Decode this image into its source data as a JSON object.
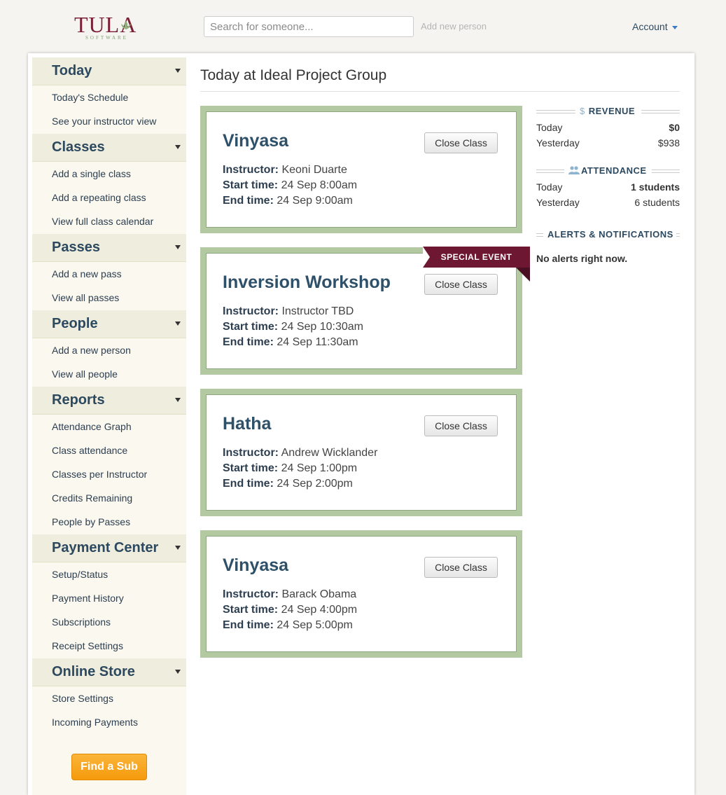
{
  "brand": {
    "name": "TULA",
    "sub": "SOFTWARE"
  },
  "header": {
    "search_placeholder": "Search for someone...",
    "add_person": "Add new person",
    "account": "Account"
  },
  "sidebar": {
    "sections": [
      {
        "title": "Today",
        "items": [
          "Today's Schedule",
          "See your instructor view"
        ]
      },
      {
        "title": "Classes",
        "items": [
          "Add a single class",
          "Add a repeating class",
          "View full class calendar"
        ]
      },
      {
        "title": "Passes",
        "items": [
          "Add a new pass",
          "View all passes"
        ]
      },
      {
        "title": "People",
        "items": [
          "Add a new person",
          "View all people"
        ]
      },
      {
        "title": "Reports",
        "items": [
          "Attendance Graph",
          "Class attendance",
          "Classes per Instructor",
          "Credits Remaining",
          "People by Passes"
        ]
      },
      {
        "title": "Payment Center",
        "items": [
          "Setup/Status",
          "Payment History",
          "Subscriptions",
          "Receipt Settings"
        ]
      },
      {
        "title": "Online Store",
        "items": [
          "Store Settings",
          "Incoming Payments"
        ]
      }
    ],
    "find_sub": "Find a Sub"
  },
  "main": {
    "title": "Today at Ideal Project Group",
    "labels": {
      "instructor": "Instructor:",
      "start": "Start time:",
      "end": "End time:"
    },
    "close_label": "Close Class",
    "special_event": "SPECIAL EVENT",
    "classes": [
      {
        "name": "Vinyasa",
        "instructor": "Keoni Duarte",
        "start": "24 Sep 8:00am",
        "end": "24 Sep 9:00am"
      },
      {
        "name": "Inversion Workshop",
        "instructor": "Instructor TBD",
        "start": "24 Sep 10:30am",
        "end": "24 Sep 11:30am"
      },
      {
        "name": "Hatha",
        "instructor": "Andrew Wicklander",
        "start": "24 Sep 1:00pm",
        "end": "24 Sep 2:00pm"
      },
      {
        "name": "Vinyasa",
        "instructor": "Barack Obama",
        "start": "24 Sep 4:00pm",
        "end": "24 Sep 5:00pm"
      }
    ]
  },
  "right": {
    "revenue": {
      "title": "REVENUE",
      "rows": [
        {
          "k": "Today",
          "v": "$0"
        },
        {
          "k": "Yesterday",
          "v": "$938"
        }
      ]
    },
    "attendance": {
      "title": "ATTENDANCE",
      "rows": [
        {
          "k": "Today",
          "v": "1 students"
        },
        {
          "k": "Yesterday",
          "v": "6 students"
        }
      ]
    },
    "alerts": {
      "title": "ALERTS & NOTIFICATIONS",
      "message": "No alerts right now."
    }
  },
  "colors": {
    "brand": "#7a1f35",
    "card_border": "#b3c9a1",
    "ribbon": "#6e1733",
    "button_orange": "#f59a0c",
    "heading": "#2c4960"
  }
}
